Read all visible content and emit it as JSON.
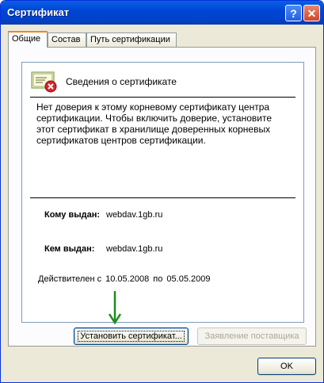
{
  "window": {
    "title": "Сертификат",
    "help_glyph": "?",
    "close_glyph": "✕"
  },
  "tabs": [
    {
      "label": "Общие",
      "active": true
    },
    {
      "label": "Состав",
      "active": false
    },
    {
      "label": "Путь сертификации",
      "active": false
    }
  ],
  "card": {
    "heading": "Сведения о сертификате",
    "warning": "Нет доверия к этому корневому сертификату центра сертификации. Чтобы включить доверие, установите этот сертификат в хранилище доверенных корневых сертификатов центров сертификации.",
    "issued_to_label": "Кому выдан:",
    "issued_to_value": "webdav.1gb.ru",
    "issued_by_label": "Кем выдан:",
    "issued_by_value": "webdav.1gb.ru",
    "valid_prefix": "Действителен с",
    "valid_from": "10.05.2008",
    "valid_mid": "по",
    "valid_to": "05.05.2009"
  },
  "buttons": {
    "install": "Установить сертификат...",
    "issuer_statement": "Заявление поставщика",
    "ok": "OK"
  },
  "colors": {
    "titlebar": "#0054e3",
    "arrow": "#1e8c1e",
    "error_badge": "#d8232a"
  }
}
